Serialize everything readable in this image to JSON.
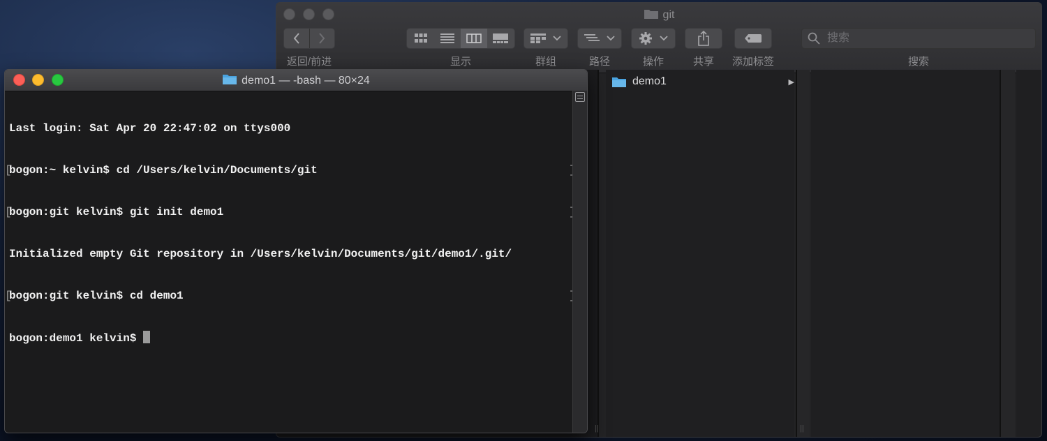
{
  "finder": {
    "title": "git",
    "toolbar": {
      "back_forward_label": "返回/前进",
      "view_label": "显示",
      "group_label": "群组",
      "path_label": "路径",
      "action_label": "操作",
      "share_label": "共享",
      "tag_label": "添加标签",
      "search_label": "搜索",
      "search_placeholder": "搜索"
    },
    "items": [
      {
        "name": "demo1",
        "type": "folder",
        "has_children": true
      }
    ]
  },
  "terminal": {
    "title": "demo1 — -bash — 80×24",
    "lines": [
      "Last login: Sat Apr 20 22:47:02 on ttys000",
      "bogon:~ kelvin$ cd /Users/kelvin/Documents/git",
      "bogon:git kelvin$ git init demo1",
      "Initialized empty Git repository in /Users/kelvin/Documents/git/demo1/.git/",
      "bogon:git kelvin$ cd demo1",
      "bogon:demo1 kelvin$ "
    ]
  },
  "colors": {
    "close": "#fc5f57",
    "minimize": "#fdbc2e",
    "zoom": "#28c840",
    "folder": "#4aa3df",
    "terminal_bg": "#1b1b1c",
    "finder_bg": "#232325"
  }
}
